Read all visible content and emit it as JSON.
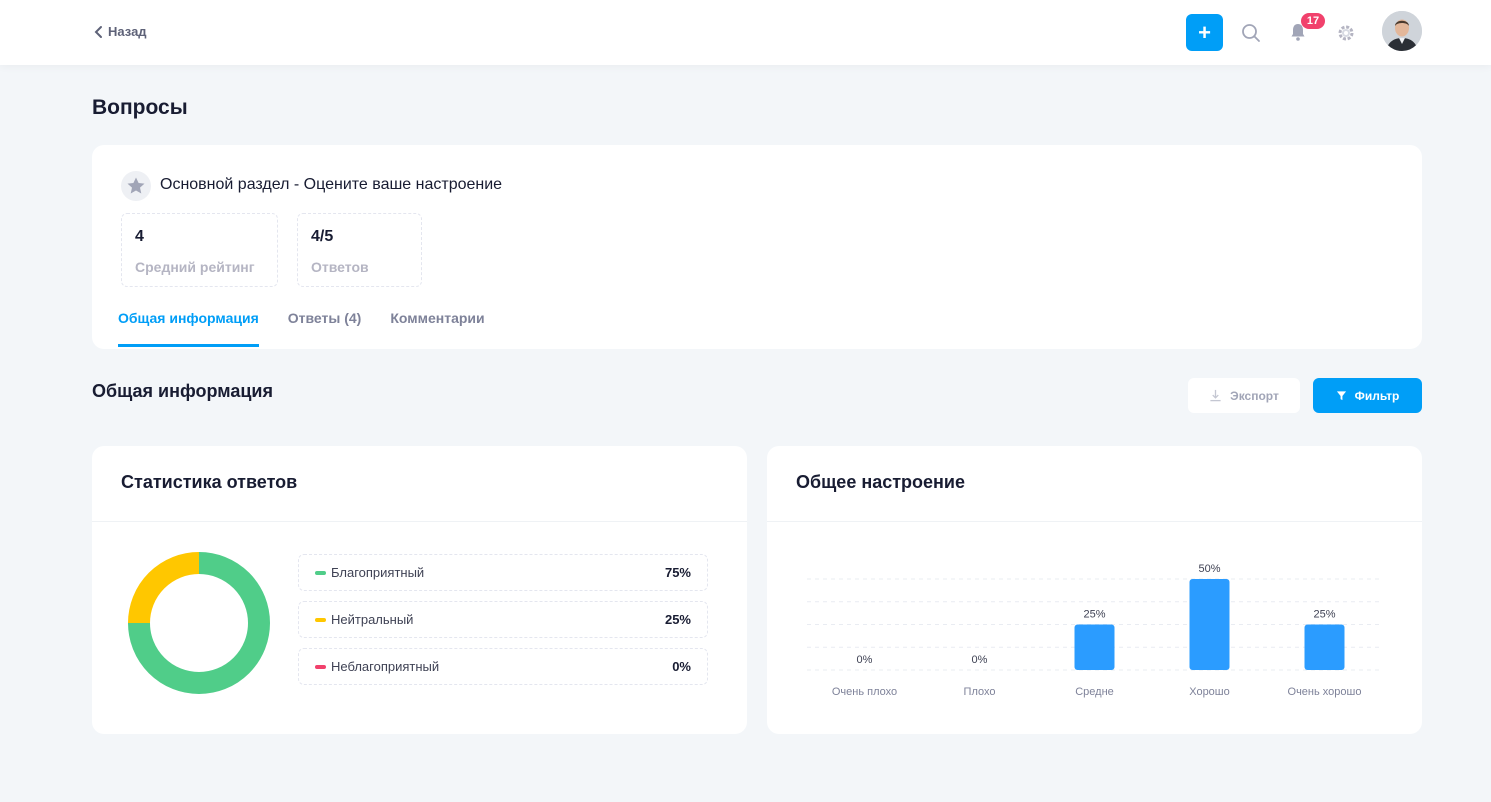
{
  "header": {
    "back_label": "Назад",
    "add_label": "+",
    "notifications_count": "17"
  },
  "page": {
    "title": "Вопросы"
  },
  "question": {
    "title": "Основной раздел - Оцените ваше настроение",
    "stats": [
      {
        "value": "4",
        "label": "Средний рейтинг"
      },
      {
        "value": "4/5",
        "label": "Ответов"
      }
    ],
    "tabs": [
      {
        "label": "Общая информация",
        "active": true
      },
      {
        "label": "Ответы (4)",
        "active": false
      },
      {
        "label": "Комментарии",
        "active": false
      }
    ]
  },
  "section": {
    "title": "Общая информация",
    "export_label": "Экспорт",
    "filter_label": "Фильтр"
  },
  "colors": {
    "accent": "#009ef7",
    "positive": "#50cd89",
    "neutral": "#ffc700",
    "negative": "#f1416c"
  },
  "stats_card": {
    "title": "Статистика ответов",
    "legend": [
      {
        "label": "Благоприятный",
        "pct": "75%",
        "color": "#50cd89"
      },
      {
        "label": "Нейтральный",
        "pct": "25%",
        "color": "#ffc700"
      },
      {
        "label": "Неблагоприятный",
        "pct": "0%",
        "color": "#f1416c"
      }
    ]
  },
  "mood_card": {
    "title": "Общее настроение"
  },
  "chart_data": [
    {
      "type": "pie",
      "categories": [
        "Благоприятный",
        "Нейтральный",
        "Неблагоприятный"
      ],
      "values": [
        75,
        25,
        0
      ],
      "colors": [
        "#50cd89",
        "#ffc700",
        "#f1416c"
      ]
    },
    {
      "type": "bar",
      "categories": [
        "Очень плохо",
        "Плохо",
        "Средне",
        "Хорошо",
        "Очень хорошо"
      ],
      "values": [
        0,
        0,
        25,
        50,
        25
      ],
      "data_labels": [
        "0%",
        "0%",
        "25%",
        "50%",
        "25%"
      ],
      "ylim": [
        0,
        50
      ],
      "grid": true,
      "color": "#2b9cff"
    }
  ]
}
